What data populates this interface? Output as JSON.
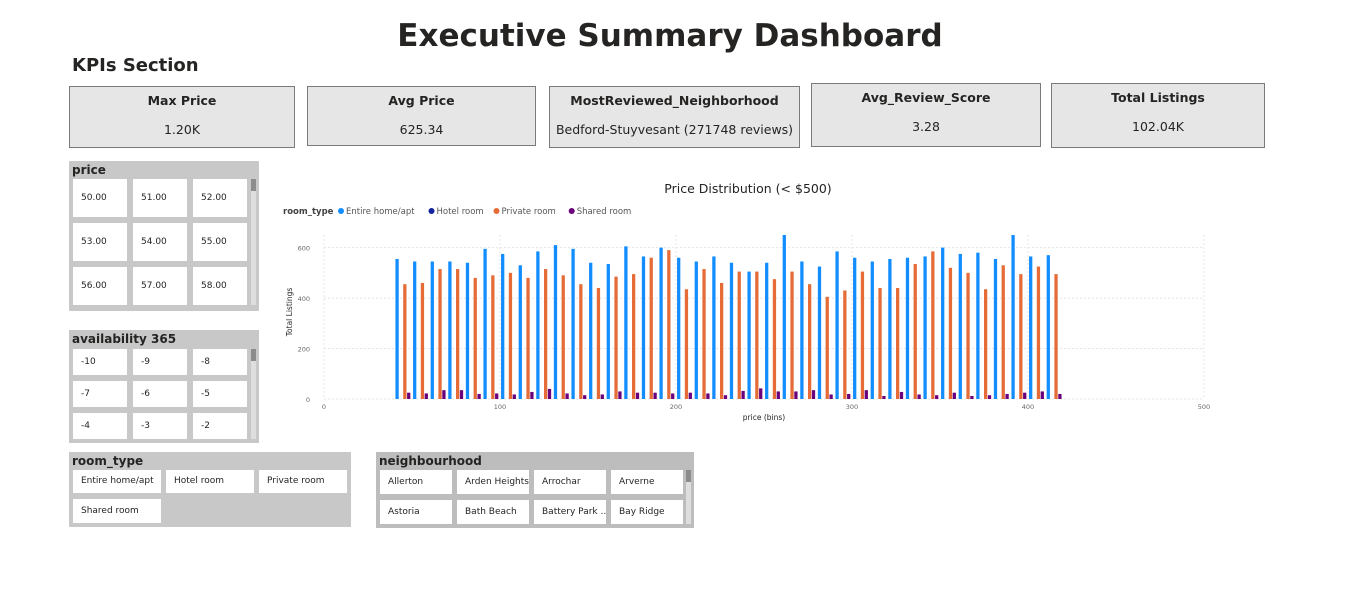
{
  "page": {
    "title": "Executive Summary Dashboard",
    "section_heading": "KPIs Section"
  },
  "kpis": [
    {
      "label": "Max Price",
      "value": "1.20K"
    },
    {
      "label": "Avg Price",
      "value": "625.34"
    },
    {
      "label": "MostReviewed_Neighborhood",
      "value": "Bedford-Stuyvesant (271748 reviews)"
    },
    {
      "label": "Avg_Review_Score",
      "value": "3.28"
    },
    {
      "label": "Total Listings",
      "value": "102.04K"
    }
  ],
  "slicers": {
    "price": {
      "title": "price",
      "items": [
        "50.00",
        "51.00",
        "52.00",
        "53.00",
        "54.00",
        "55.00",
        "56.00",
        "57.00",
        "58.00"
      ]
    },
    "availability": {
      "title": "availability 365",
      "items": [
        "-10",
        "-9",
        "-8",
        "-7",
        "-6",
        "-5",
        "-4",
        "-3",
        "-2"
      ]
    },
    "room_type": {
      "title": "room_type",
      "items": [
        "Entire home/apt",
        "Hotel room",
        "Private room",
        "Shared room"
      ]
    },
    "neighbourhood": {
      "title": "neighbourhood",
      "items": [
        "Allerton",
        "Arden Heights",
        "Arrochar",
        "Arverne",
        "Astoria",
        "Bath Beach",
        "Battery Park ...",
        "Bay Ridge"
      ]
    }
  },
  "chart_data": {
    "type": "bar",
    "title": "Price Distribution (< $500)",
    "legend_title": "room_type",
    "legend_position": "top-left",
    "xlabel": "price (bins)",
    "ylabel": "Total Listings",
    "xlim": [
      0,
      500
    ],
    "ylim": [
      0,
      650
    ],
    "x_ticks": [
      0,
      100,
      200,
      300,
      400,
      500
    ],
    "y_ticks": [
      0,
      200,
      400,
      600
    ],
    "grid": true,
    "x": [
      45,
      55,
      65,
      75,
      85,
      95,
      105,
      115,
      125,
      135,
      145,
      155,
      165,
      175,
      185,
      195,
      205,
      215,
      225,
      235,
      245,
      255,
      265,
      275,
      285,
      295,
      305,
      315,
      325,
      335,
      345,
      355,
      365,
      375,
      385,
      395,
      405,
      415,
      425,
      435,
      445,
      455,
      465,
      475,
      485
    ],
    "series": [
      {
        "name": "Entire home/apt",
        "color": "#118dff",
        "values": [
          555,
          545,
          545,
          545,
          540,
          595,
          575,
          530,
          585,
          610,
          595,
          540,
          535,
          605,
          565,
          600,
          560,
          545,
          565,
          540,
          505,
          540,
          650,
          545,
          525,
          585,
          560,
          545,
          555,
          560,
          565,
          600,
          575,
          580,
          555,
          650,
          565,
          570,
          0,
          0,
          0,
          0,
          0,
          0,
          0
        ]
      },
      {
        "name": "Hotel room",
        "color": "#12239e",
        "values": [
          0,
          0,
          0,
          0,
          0,
          0,
          0,
          0,
          0,
          0,
          0,
          0,
          0,
          0,
          0,
          0,
          0,
          0,
          0,
          0,
          0,
          0,
          0,
          0,
          0,
          0,
          0,
          0,
          0,
          0,
          0,
          0,
          0,
          0,
          0,
          0,
          0,
          0,
          0,
          0,
          0,
          0,
          0,
          0,
          0
        ]
      },
      {
        "name": "Private room",
        "color": "#e66c37",
        "values": [
          455,
          460,
          515,
          515,
          480,
          490,
          500,
          480,
          515,
          490,
          455,
          440,
          485,
          495,
          560,
          590,
          435,
          515,
          460,
          505,
          505,
          475,
          505,
          455,
          405,
          430,
          505,
          440,
          440,
          535,
          585,
          520,
          500,
          435,
          530,
          495,
          525,
          495,
          0,
          0,
          0,
          0,
          0,
          0,
          0
        ]
      },
      {
        "name": "Shared room",
        "color": "#6b007b",
        "values": [
          25,
          22,
          35,
          35,
          20,
          22,
          18,
          28,
          40,
          22,
          15,
          18,
          30,
          25,
          25,
          22,
          25,
          22,
          15,
          32,
          42,
          30,
          30,
          35,
          18,
          20,
          35,
          12,
          28,
          18,
          15,
          25,
          12,
          15,
          20,
          25,
          30,
          20,
          0,
          0,
          0,
          0,
          0,
          0,
          0
        ]
      }
    ]
  }
}
